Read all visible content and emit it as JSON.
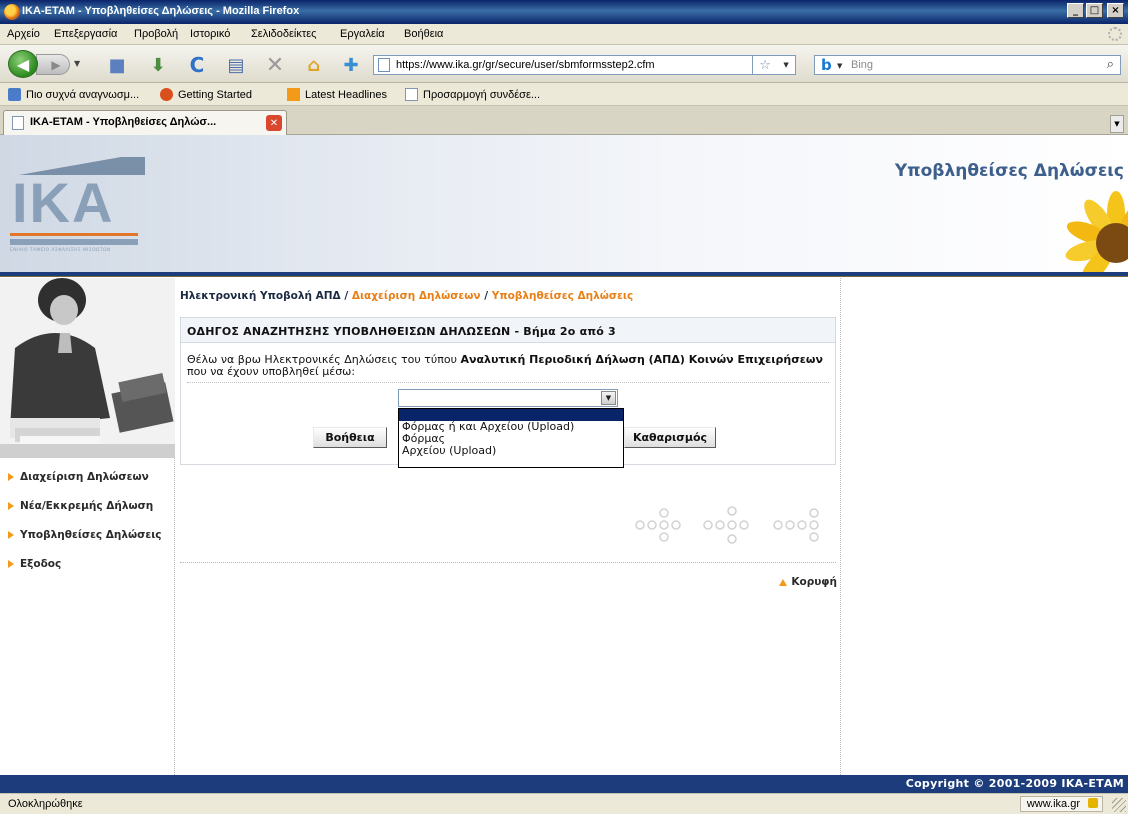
{
  "window": {
    "title": "ΙΚΑ-ΕΤΑΜ - Υποβληθείσες Δηλώσεις - Mozilla Firefox",
    "controls": {
      "minimize": "_",
      "maximize": "□",
      "close": "×"
    }
  },
  "menu": {
    "items": [
      "Αρχείο",
      "Επεξεργασία",
      "Προβολή",
      "Ιστορικό",
      "Σελιδοδείκτες",
      "Εργαλεία",
      "Βοήθεια"
    ]
  },
  "navbar": {
    "url": "https://www.ika.gr/gr/secure/user/sbmformsstep2.cfm",
    "search_placeholder": "Bing",
    "icons": [
      "back-icon",
      "forward-icon",
      "bookmark-icon",
      "download-icon",
      "reload-icon",
      "print-icon",
      "stop-icon",
      "home-icon",
      "addon-icon",
      "star-icon",
      "search-icon"
    ]
  },
  "bookmarks": {
    "items": [
      "Πιο συχνά αναγνωσμ...",
      "Getting Started",
      "Latest Headlines",
      "Προσαρμογή συνδέσε..."
    ]
  },
  "tab": {
    "label": "ΙΚΑ-ΕΤΑΜ - Υποβληθείσες Δηλώσ..."
  },
  "header": {
    "logo_text": "ΙΚΑ",
    "logo_sub": "ΕΝΙΑΙΟ ΤΑΜΕΙΟ ΑΣΦΑΛΙΣΗΣ ΜΙΣΘΩΤΩΝ",
    "title": "Υποβληθείσες Δηλώσεις"
  },
  "sidebar": {
    "items": [
      {
        "label": "Διαχείριση Δηλώσεων"
      },
      {
        "label": "Νέα/Εκκρεμής Δήλωση"
      },
      {
        "label": "Υποβληθείσες Δηλώσεις"
      },
      {
        "label": "Εξοδος"
      }
    ]
  },
  "breadcrumb": {
    "root": "Ηλεκτρονική Υποβολή ΑΠΔ",
    "separator": "/",
    "link": "Διαχείριση Δηλώσεων",
    "current": "Υποβληθείσες Δηλώσεις"
  },
  "panel": {
    "heading": "ΟΔΗΓΟΣ ΑΝΑΖΗΤΗΣΗΣ ΥΠΟΒΛΗΘΕΙΣΩΝ ΔΗΛΩΣΕΩΝ - Βήμα 2ο από 3",
    "desc_prefix": "Θέλω να βρω Ηλεκτρονικές Δηλώσεις του τύπου ",
    "desc_bold": "Αναλυτική Περιοδική Δήλωση (ΑΠΔ) Κοινών Επιχειρήσεων",
    "desc_suffix": " που να έχουν υποβληθεί μέσω:",
    "select_value": "",
    "options": [
      "",
      "Φόρμας ή και Αρχείου (Upload)",
      "Φόρμας",
      "Αρχείου (Upload)"
    ],
    "help_label": "Βοήθεια",
    "clear_label": "Καθαρισμός"
  },
  "top_link": "Κορυφή",
  "footer": {
    "copyright": "Copyright © 2001-2009 ΙΚΑ-ΕΤΑΜ"
  },
  "status": {
    "text": "Ολοκληρώθηκε",
    "domain": "www.ika.gr"
  },
  "colors": {
    "titlebar": "#0a246a",
    "header_rule": "#1c3c7b",
    "accent_orange": "#e88018",
    "brand_blue": "#3d5f8c",
    "selection": "#0a246a"
  }
}
